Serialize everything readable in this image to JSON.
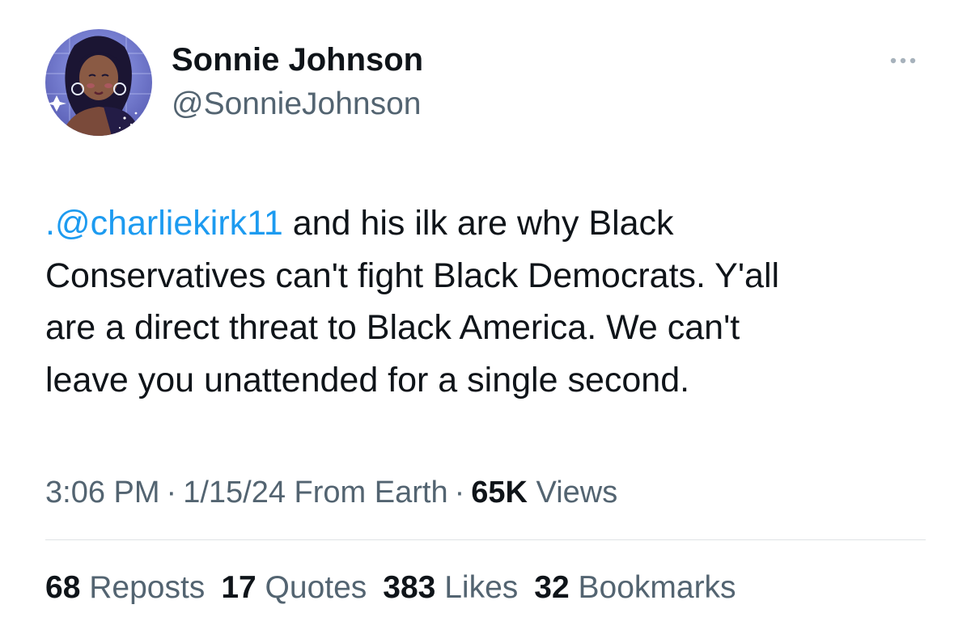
{
  "user": {
    "display_name": "Sonnie Johnson",
    "handle": "@SonnieJohnson",
    "avatar_icon": "illustrated-portrait-avatar"
  },
  "more_icon": "more-options-icon",
  "tweet": {
    "mention": ".@charliekirk11",
    "lines": [
      " and his ilk are why Black",
      "Conservatives can't fight Black Democrats. Y'all",
      "are a direct threat to Black America. We can't",
      "leave you unattended for a single second."
    ]
  },
  "meta": {
    "time": "3:06 PM",
    "separator": "·",
    "date": "1/15/24",
    "source": "From Earth",
    "views_count": "65K",
    "views_label": "Views"
  },
  "stats": [
    {
      "count": "68",
      "label": "Reposts"
    },
    {
      "count": "17",
      "label": "Quotes"
    },
    {
      "count": "383",
      "label": "Likes"
    },
    {
      "count": "32",
      "label": "Bookmarks"
    }
  ],
  "colors": {
    "text": "#0f1419",
    "secondary": "#536471",
    "accent": "#1d9bf0",
    "divider": "#dfe3e6"
  }
}
